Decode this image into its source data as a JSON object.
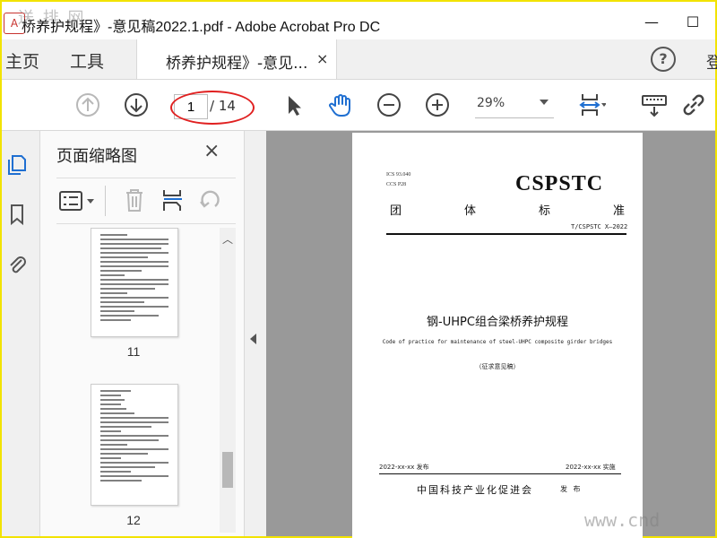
{
  "window": {
    "title": "桥养护规程》-意见稿2022.1.pdf - Adobe Acrobat Pro DC",
    "app_icon": "acrobat-icon",
    "minimize_label": "—",
    "maximize_label": "☐"
  },
  "tabs": {
    "home": "主页",
    "tools": "工具",
    "document": "桥养护规程》-意见...",
    "close": "×",
    "help": "?",
    "cut_text": "登"
  },
  "toolbar": {
    "current_page": "1",
    "total_pages": "/ 14",
    "zoom": "29%"
  },
  "thumb_panel": {
    "title": "页面缩略图",
    "close": "×",
    "pages": [
      {
        "number": "11"
      },
      {
        "number": "12"
      }
    ]
  },
  "document_page": {
    "meta_ics": "ICS 93.040",
    "meta_ccs": "CCS P28",
    "brand": "CSPSTC",
    "tuanti": [
      "团",
      "体",
      "标",
      "准"
    ],
    "standard_no": "T/CSPSTC X—2022",
    "title_cn": "钢-UHPC组合梁桥养护规程",
    "title_en": "Code of practice for maintenance of steel-UHPC composite girder bridges",
    "draft_note": "（征求意见稿）",
    "issue_date": "2022-xx-xx 发布",
    "impl_date": "2022-xx-xx 实施",
    "org": "中国科技产业化促进会",
    "publish": "发 布"
  },
  "watermarks": {
    "top_left": "送 排 网",
    "bottom_right": "www.cnd"
  },
  "colors": {
    "annotation": "#e02020",
    "frame": "#f2e300",
    "doc_background": "#999999"
  }
}
